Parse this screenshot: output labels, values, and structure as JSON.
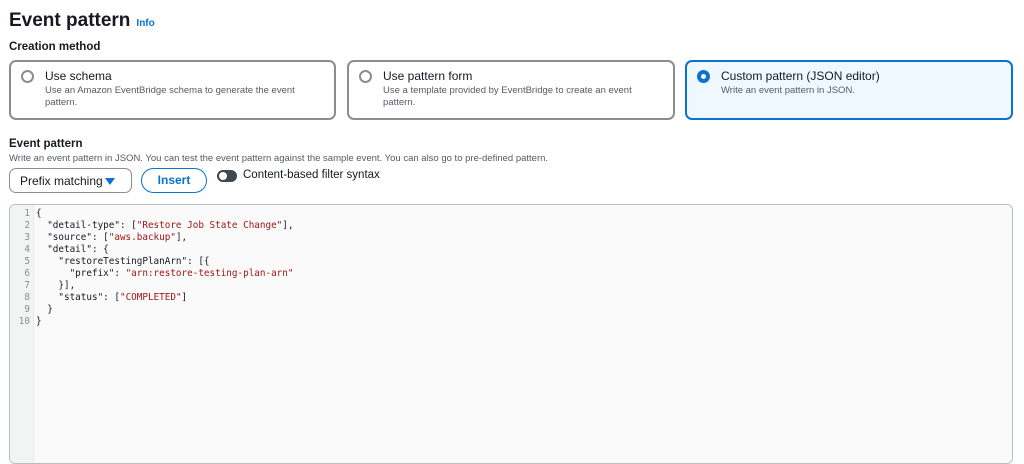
{
  "header": {
    "title": "Event pattern",
    "info": "Info"
  },
  "creation": {
    "label": "Creation method",
    "options": [
      {
        "title": "Use schema",
        "desc": "Use an Amazon EventBridge schema to generate the event pattern.",
        "selected": false
      },
      {
        "title": "Use pattern form",
        "desc": "Use a template provided by EventBridge to create an event pattern.",
        "selected": false
      },
      {
        "title": "Custom pattern (JSON editor)",
        "desc": "Write an event pattern in JSON.",
        "selected": true
      }
    ]
  },
  "pattern": {
    "label": "Event pattern",
    "desc": "Write an event pattern in JSON. You can test the event pattern against the sample event. You can also go to pre-defined pattern.",
    "dropdown": "Prefix matching",
    "insert": "Insert",
    "toggle_label": "Content-based filter syntax",
    "toggle_on": false
  },
  "editor": {
    "lines": [
      [
        {
          "t": "{",
          "s": 0
        }
      ],
      [
        {
          "t": "  \"detail-type\": [",
          "s": 0
        },
        {
          "t": "\"Restore Job State Change\"",
          "s": 1
        },
        {
          "t": "],",
          "s": 0
        }
      ],
      [
        {
          "t": "  \"source\": [",
          "s": 0
        },
        {
          "t": "\"aws.backup\"",
          "s": 1
        },
        {
          "t": "],",
          "s": 0
        }
      ],
      [
        {
          "t": "  \"detail\": {",
          "s": 0
        }
      ],
      [
        {
          "t": "    \"restoreTestingPlanArn\": [{",
          "s": 0
        }
      ],
      [
        {
          "t": "      \"prefix\": ",
          "s": 0
        },
        {
          "t": "\"arn:restore-testing-plan-arn\"",
          "s": 1
        }
      ],
      [
        {
          "t": "    }],",
          "s": 0
        }
      ],
      [
        {
          "t": "    \"status\": [",
          "s": 0
        },
        {
          "t": "\"COMPLETED\"",
          "s": 1
        },
        {
          "t": "]",
          "s": 0
        }
      ],
      [
        {
          "t": "  }",
          "s": 0
        }
      ],
      [
        {
          "t": "}",
          "s": 0
        }
      ]
    ]
  }
}
